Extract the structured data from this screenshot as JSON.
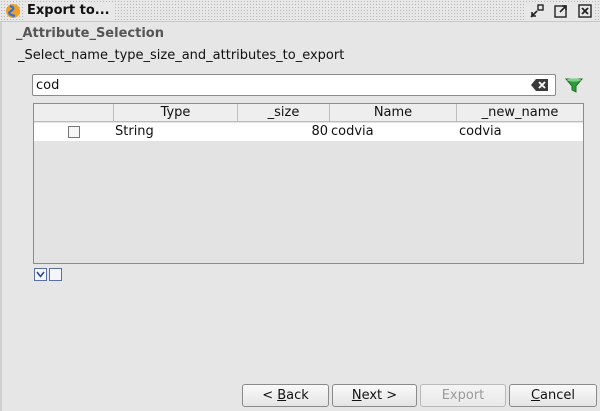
{
  "window": {
    "title": "Export to...",
    "icons": [
      "app-icon",
      "restore-icon",
      "maximize-icon",
      "close-icon"
    ]
  },
  "header": {
    "section_title": "_Attribute_Selection",
    "subtitle": "_Select_name_type_size_and_attributes_to_export"
  },
  "search": {
    "value": "cod",
    "placeholder": "",
    "clear_icon": "clear-text-icon",
    "filter_icon": "filter-funnel-icon"
  },
  "table": {
    "columns": [
      "",
      "Type",
      "_size",
      "Name",
      "_new_name"
    ],
    "rows": [
      {
        "checked": false,
        "type": "String",
        "size": "80",
        "name": "codvia",
        "new_name": "codvia"
      }
    ]
  },
  "selection_buttons": [
    "select-all-icon",
    "deselect-all-icon"
  ],
  "buttons": {
    "back": {
      "pre": "< ",
      "mnemonic": "B",
      "post": "ack"
    },
    "next": {
      "pre": "",
      "mnemonic": "N",
      "post": "ext >"
    },
    "export": "Export",
    "cancel": {
      "pre": "",
      "mnemonic": "C",
      "post": "ancel"
    }
  },
  "colors": {
    "accent": "#5a6fa6",
    "filter_green": "#2e9b3a",
    "app_icon_orange": "#f0a020",
    "app_icon_blue": "#3a6ec9"
  }
}
